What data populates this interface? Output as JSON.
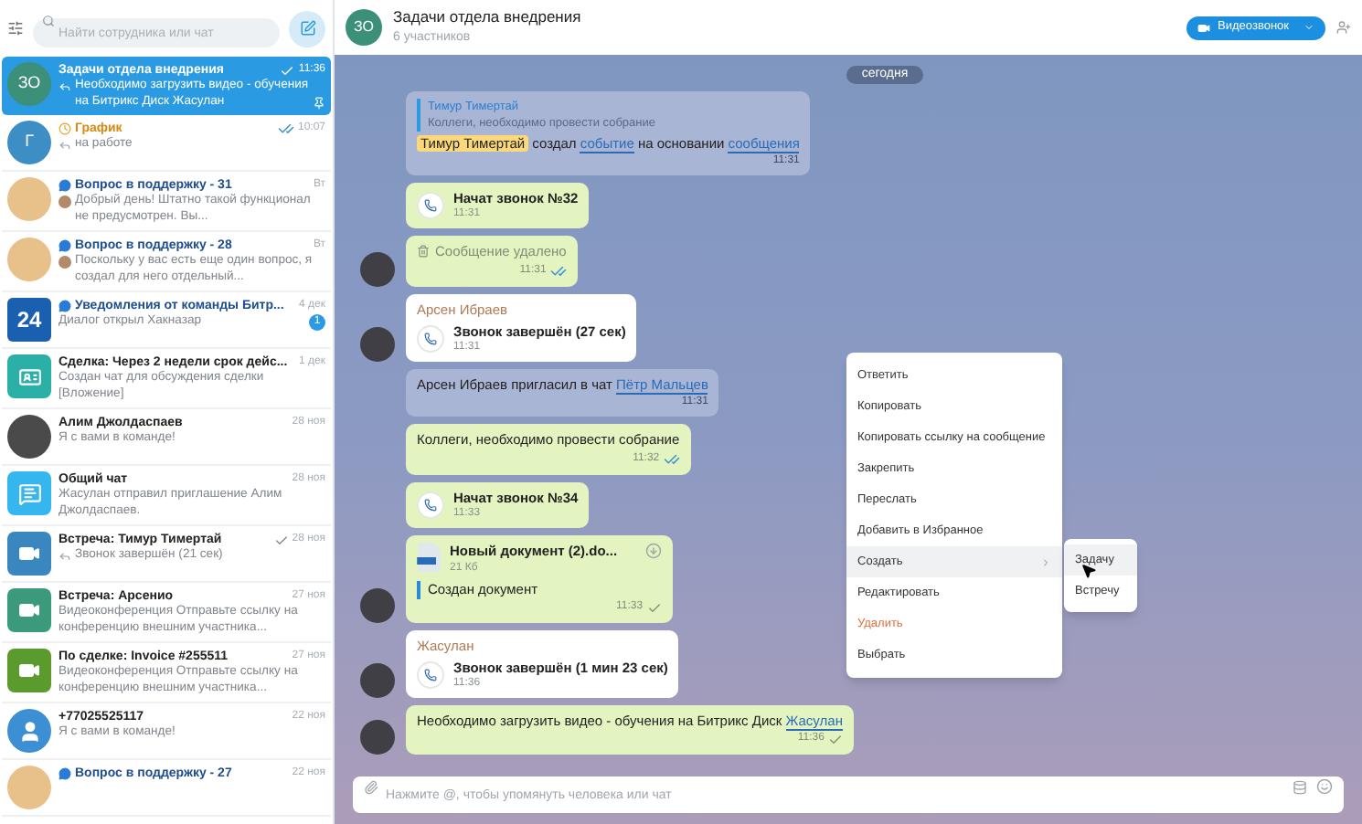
{
  "sidebar": {
    "search": {
      "placeholder": "Найти сотрудника или чат"
    },
    "items": [
      {
        "avatar": {
          "kind": "initials",
          "text": "ЗО",
          "color": "#3c8f78"
        },
        "kind": "plain",
        "title": "Задачи отдела внедрения",
        "preview": {
          "kind": "reply",
          "text": "Необходимо загрузить видео - обучения на Битрикс Диск Жасулан"
        },
        "time": "11:36",
        "read": false,
        "pinned": true,
        "selected": true
      },
      {
        "avatar": {
          "kind": "initials",
          "text": "Г",
          "color": "#3d8ec4"
        },
        "kind": "schedule",
        "title": "График",
        "preview": {
          "kind": "reply",
          "text": "на работе"
        },
        "time": "10:07",
        "read": true,
        "pinned": false,
        "selected": false
      },
      {
        "avatar": {
          "kind": "group-photo"
        },
        "kind": "support",
        "title": "Вопрос в поддержку - 31",
        "preview": {
          "kind": "sender",
          "text": "Добрый день! Штатно такой функционал не предусмотрен. Вы..."
        },
        "time": "Вт",
        "pinned": false,
        "selected": false
      },
      {
        "avatar": {
          "kind": "group-photo"
        },
        "kind": "support",
        "title": "Вопрос в поддержку - 28",
        "preview": {
          "kind": "sender",
          "text": "Поскольку у вас есть еще один вопрос, я создал для него отдельный..."
        },
        "time": "Вт",
        "pinned": false,
        "selected": false
      },
      {
        "avatar": {
          "kind": "logo",
          "text": "24",
          "color": "#1b5fb0"
        },
        "kind": "support",
        "title": "Уведомления от команды Битр...",
        "preview": {
          "kind": "plain",
          "text": "Диалог открыл Хакназар"
        },
        "time": "4 дек",
        "counter": "1",
        "pinned": false,
        "selected": false
      },
      {
        "avatar": {
          "kind": "deal",
          "color": "#2bb0a8"
        },
        "kind": "plain",
        "title": "Сделка: Через 2 недели срок дейс...",
        "preview": {
          "kind": "plain",
          "text": "Создан чат для обсуждения сделки [Вложение]"
        },
        "time": "1 дек",
        "pinned": false,
        "selected": false
      },
      {
        "avatar": {
          "kind": "photo"
        },
        "kind": "plain",
        "title": "Алим Джолдаспаев",
        "preview": {
          "kind": "plain",
          "text": "Я с вами в команде!"
        },
        "time": "28 ноя",
        "pinned": false,
        "selected": false
      },
      {
        "avatar": {
          "kind": "chat",
          "color": "#35b6ee"
        },
        "kind": "plain",
        "title": "Общий чат",
        "preview": {
          "kind": "plain",
          "text": "Жасулан отправил приглашение Алим Джолдаспаев."
        },
        "time": "28 ноя",
        "pinned": false,
        "selected": false
      },
      {
        "avatar": {
          "kind": "video",
          "color": "#3a86bf"
        },
        "kind": "plain",
        "title": "Встреча: Тимур Тимертай",
        "preview": {
          "kind": "reply",
          "text": "Звонок завершён (21 сек)"
        },
        "time": "28 ноя",
        "read": false,
        "pinned": false,
        "selected": false
      },
      {
        "avatar": {
          "kind": "video",
          "color": "#3b9a7c"
        },
        "kind": "plain",
        "title": "Встреча: Арсенио",
        "preview": {
          "kind": "plain",
          "text": "Видеоконференция Отправьте ссылку на конференцию внешним участника..."
        },
        "time": "27 ноя",
        "pinned": false,
        "selected": false
      },
      {
        "avatar": {
          "kind": "video",
          "color": "#5b9a2c"
        },
        "kind": "plain",
        "title": "По сделке: Invoice #255511",
        "preview": {
          "kind": "plain",
          "text": "Видеоконференция Отправьте ссылку на конференцию внешним участника..."
        },
        "time": "27 ноя",
        "pinned": false,
        "selected": false
      },
      {
        "avatar": {
          "kind": "user",
          "color": "#3b8fd2"
        },
        "kind": "plain",
        "title": "+77025525117",
        "preview": {
          "kind": "plain",
          "text": "Я с вами в команде!"
        },
        "time": "22 ноя",
        "pinned": false,
        "selected": false
      },
      {
        "avatar": {
          "kind": "group-photo"
        },
        "kind": "support",
        "title": "Вопрос в поддержку - 27",
        "time": "22 ноя",
        "pinned": false,
        "selected": false
      }
    ]
  },
  "header": {
    "avatar": {
      "text": "ЗО",
      "color": "#3c8f78"
    },
    "title": "Задачи отдела внедрения",
    "subtitle": "6 участников",
    "video_button": "Видеозвонок"
  },
  "messages": [
    {
      "kind": "date",
      "text": "сегодня"
    },
    {
      "kind": "quote",
      "quote_author": "Тимур Тимертай",
      "quote_text": "Коллеги, необходимо провести собрание",
      "parts": [
        {
          "kind": "mention",
          "text": "Тимур Тимертай"
        },
        {
          "kind": "text",
          "text": " создал "
        },
        {
          "kind": "link",
          "text": "событие"
        },
        {
          "kind": "text",
          "text": " на основании "
        },
        {
          "kind": "link",
          "text": "сообщения"
        }
      ],
      "time": "11:31"
    },
    {
      "kind": "call",
      "own": true,
      "text": "Начат звонок №32",
      "time": "11:31",
      "avatar": false
    },
    {
      "kind": "deleted",
      "own": true,
      "text": "Сообщение удалено",
      "time": "11:31",
      "read": true,
      "avatar": true
    },
    {
      "kind": "call",
      "own": false,
      "author": "Арсен Ибраев",
      "text": "Звонок завершён (27 сек)",
      "time": "11:31",
      "avatar": true
    },
    {
      "kind": "system",
      "parts": [
        {
          "kind": "text",
          "text": "Арсен Ибраев пригласил в чат "
        },
        {
          "kind": "link",
          "text": "Пётр Мальцев"
        }
      ],
      "time": "11:31"
    },
    {
      "kind": "text",
      "own": true,
      "parts": [
        {
          "kind": "text",
          "text": "Коллеги, необходимо провести собрание"
        }
      ],
      "time": "11:32",
      "read": true,
      "avatar": false
    },
    {
      "kind": "call",
      "own": true,
      "text": "Начат звонок №34",
      "time": "11:33",
      "avatar": false
    },
    {
      "kind": "file",
      "own": true,
      "file_name": "Новый документ (2).do...",
      "file_size": "21 Кб",
      "text": "Создан документ",
      "time": "11:33",
      "read": false,
      "avatar": true
    },
    {
      "kind": "call",
      "own": false,
      "author": "Жасулан",
      "text": "Звонок завершён (1 мин 23 сек)",
      "time": "11:36",
      "avatar": true
    },
    {
      "kind": "text",
      "own": true,
      "parts": [
        {
          "kind": "text",
          "text": "Необходимо загрузить видео - обучения на Битрикс Диск "
        },
        {
          "kind": "link",
          "text": "Жасулан"
        }
      ],
      "time": "11:36",
      "read": false,
      "avatar": true
    }
  ],
  "context_menu": {
    "items": [
      {
        "label": "Ответить",
        "kind": "action",
        "selected": false
      },
      {
        "label": "Копировать",
        "kind": "action",
        "selected": false
      },
      {
        "label": "Копировать ссылку на сообщение",
        "kind": "action",
        "selected": false
      },
      {
        "label": "Закрепить",
        "kind": "action",
        "selected": false
      },
      {
        "label": "Переслать",
        "kind": "action",
        "selected": false
      },
      {
        "label": "Добавить в Избранное",
        "kind": "action",
        "selected": false
      },
      {
        "label": "Создать",
        "kind": "submenu",
        "selected": true
      },
      {
        "label": "Редактировать",
        "kind": "action",
        "selected": false
      },
      {
        "label": "Удалить",
        "kind": "danger",
        "selected": false
      },
      {
        "label": "Выбрать",
        "kind": "action",
        "selected": false
      }
    ],
    "submenu": [
      {
        "label": "Задачу",
        "selected": true
      },
      {
        "label": "Встречу",
        "selected": false
      }
    ]
  },
  "composer": {
    "placeholder": "Нажмите @, чтобы упомянуть человека или чат"
  }
}
